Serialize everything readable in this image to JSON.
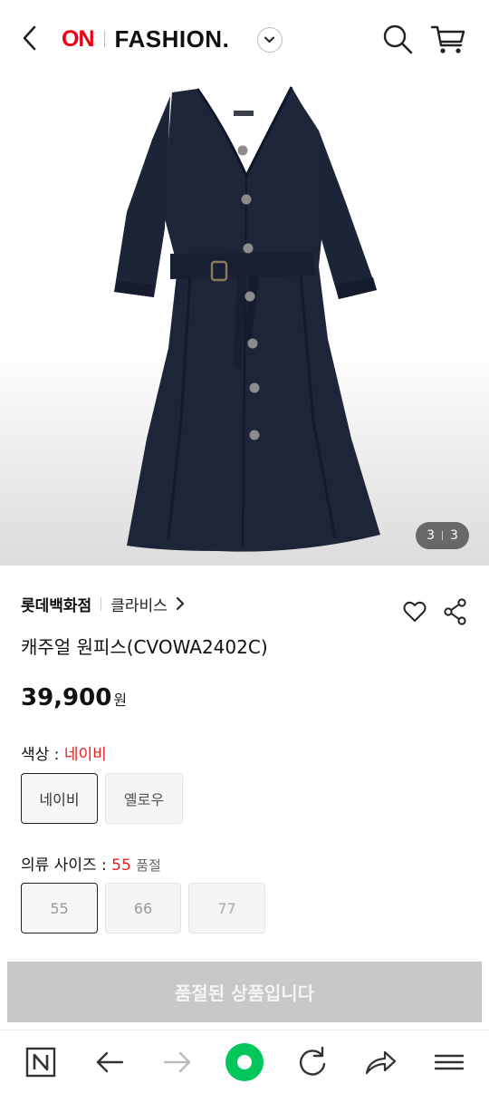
{
  "header": {
    "logo_on": "ON",
    "logo_fashion": "FASHION.",
    "back_icon": "chevron-left-icon",
    "search_icon": "search-icon",
    "cart_icon": "cart-icon"
  },
  "gallery": {
    "current": "3",
    "total": "3"
  },
  "product": {
    "brand": "롯데백화점",
    "sub_brand": "클라비스",
    "name": "캐주얼 원피스(CVOWA2402C)",
    "price": "39,900",
    "currency": "원"
  },
  "color_option": {
    "label": "색상 : ",
    "selected": "네이비",
    "options": [
      "네이비",
      "옐로우"
    ]
  },
  "size_option": {
    "label": "의류 사이즈 : ",
    "selected": "55",
    "status": "품절",
    "options": [
      "55",
      "66",
      "77"
    ]
  },
  "soldout_button": "품절된 상품입니다",
  "colors": {
    "brand_red": "#e60012",
    "accent_red": "#e02020",
    "dress_navy": "#1c2438",
    "disabled_button": "#c8c8c8",
    "naver_green": "#03c75a"
  },
  "bottom_nav": [
    "n-logo-icon",
    "arrow-left-icon",
    "arrow-right-icon",
    "green-dot-icon",
    "refresh-icon",
    "share-arrow-icon",
    "menu-icon"
  ]
}
